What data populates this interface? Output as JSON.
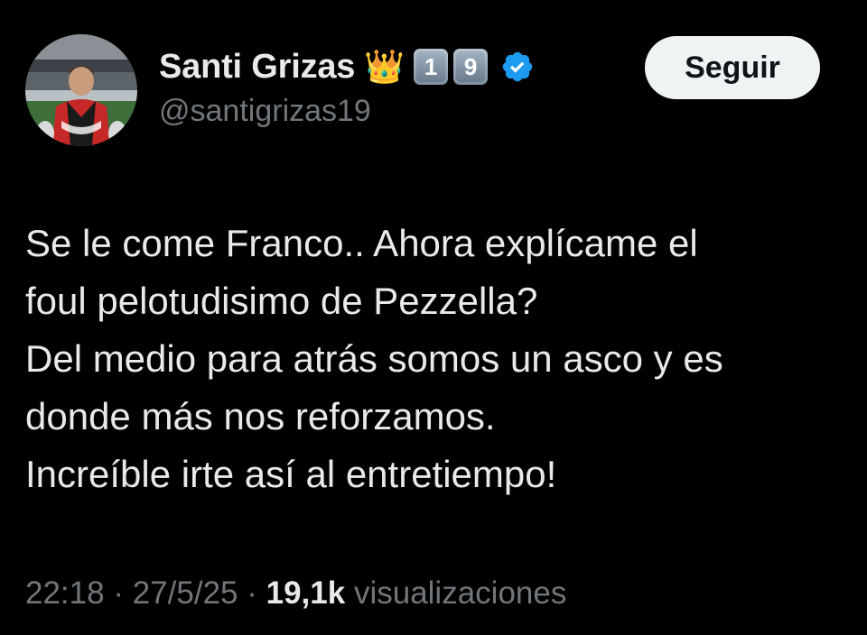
{
  "author": {
    "display_name": "Santi Grizas",
    "emojis": {
      "crown": "👑",
      "keycap_1": "1",
      "keycap_2": "9"
    },
    "handle": "@santigrizas19",
    "verified_color": "#1d9bf0"
  },
  "follow_button": {
    "label": "Seguir"
  },
  "tweet": {
    "lines": [
      "Se le come Franco.. Ahora explícame el",
      "foul pelotudisimo de Pezzella?",
      "Del medio para atrás somos un asco y es",
      "donde más nos reforzamos.",
      "Increíble irte así al entretiempo!"
    ]
  },
  "meta": {
    "time": "22:18",
    "separator": "·",
    "date": "27/5/25",
    "views_count": "19,1k",
    "views_label": "visualizaciones"
  },
  "colors": {
    "background": "#000000",
    "text_primary": "#e7e9ea",
    "text_secondary": "#71767b",
    "button_bg": "#eff3f4",
    "button_text": "#0f1419"
  }
}
